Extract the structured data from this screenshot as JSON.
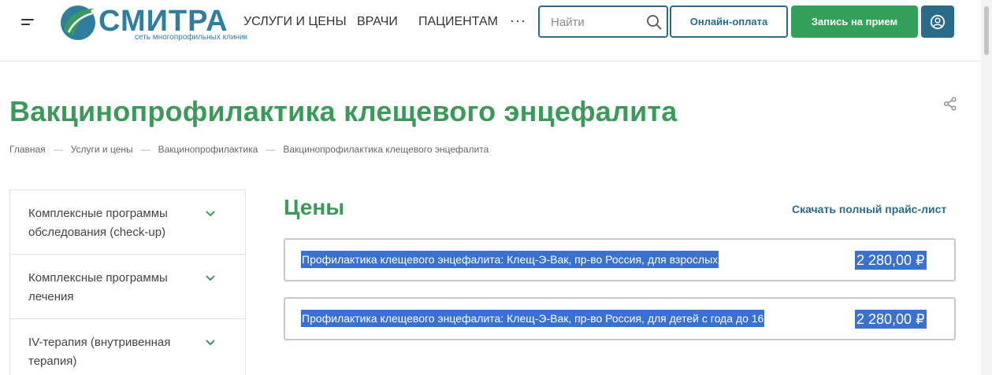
{
  "header": {
    "logo": {
      "name": "СМИТРА",
      "tagline": "сеть многопрофильных клиник"
    },
    "nav": [
      "УСЛУГИ И ЦЕНЫ",
      "ВРАЧИ",
      "ПАЦИЕНТАМ"
    ],
    "more": "···",
    "search": {
      "placeholder": "Найти",
      "value": ""
    },
    "pay_button": "Онлайн-оплата",
    "book_button": "Запись на прием"
  },
  "page": {
    "title": "Вакцинопрофилактика клещевого энцефалита",
    "breadcrumbs": [
      "Главная",
      "Услуги и цены",
      "Вакцинопрофилактика",
      "Вакцинопрофилактика клещевого энцефалита"
    ]
  },
  "sidebar": {
    "items": [
      {
        "label": "Комплексные программы обследования (check-up)"
      },
      {
        "label": "Комплексные программы лечения"
      },
      {
        "label": "IV-терапия (внутривенная терапия)"
      }
    ]
  },
  "prices": {
    "title": "Цены",
    "download_label": "Скачать полный прайс-лист",
    "rows": [
      {
        "name": "Профилактика клещевого энцефалита: Клещ-Э-Вак, пр-во Россия, для взрослых",
        "price": "2 280,00 ₽"
      },
      {
        "name": "Профилактика клещевого энцефалита: Клещ-Э-Вак, пр-во Россия, для детей с года до 16",
        "price": "2 280,00 ₽"
      }
    ]
  },
  "colors": {
    "brand_green": "#3b9a5a",
    "brand_blue": "#2b6b8a",
    "button_green": "#34a05a",
    "selection": "#3a70d0"
  },
  "icons": [
    "menu-icon",
    "search-icon",
    "user-icon",
    "share-icon",
    "chevron-down-icon"
  ]
}
